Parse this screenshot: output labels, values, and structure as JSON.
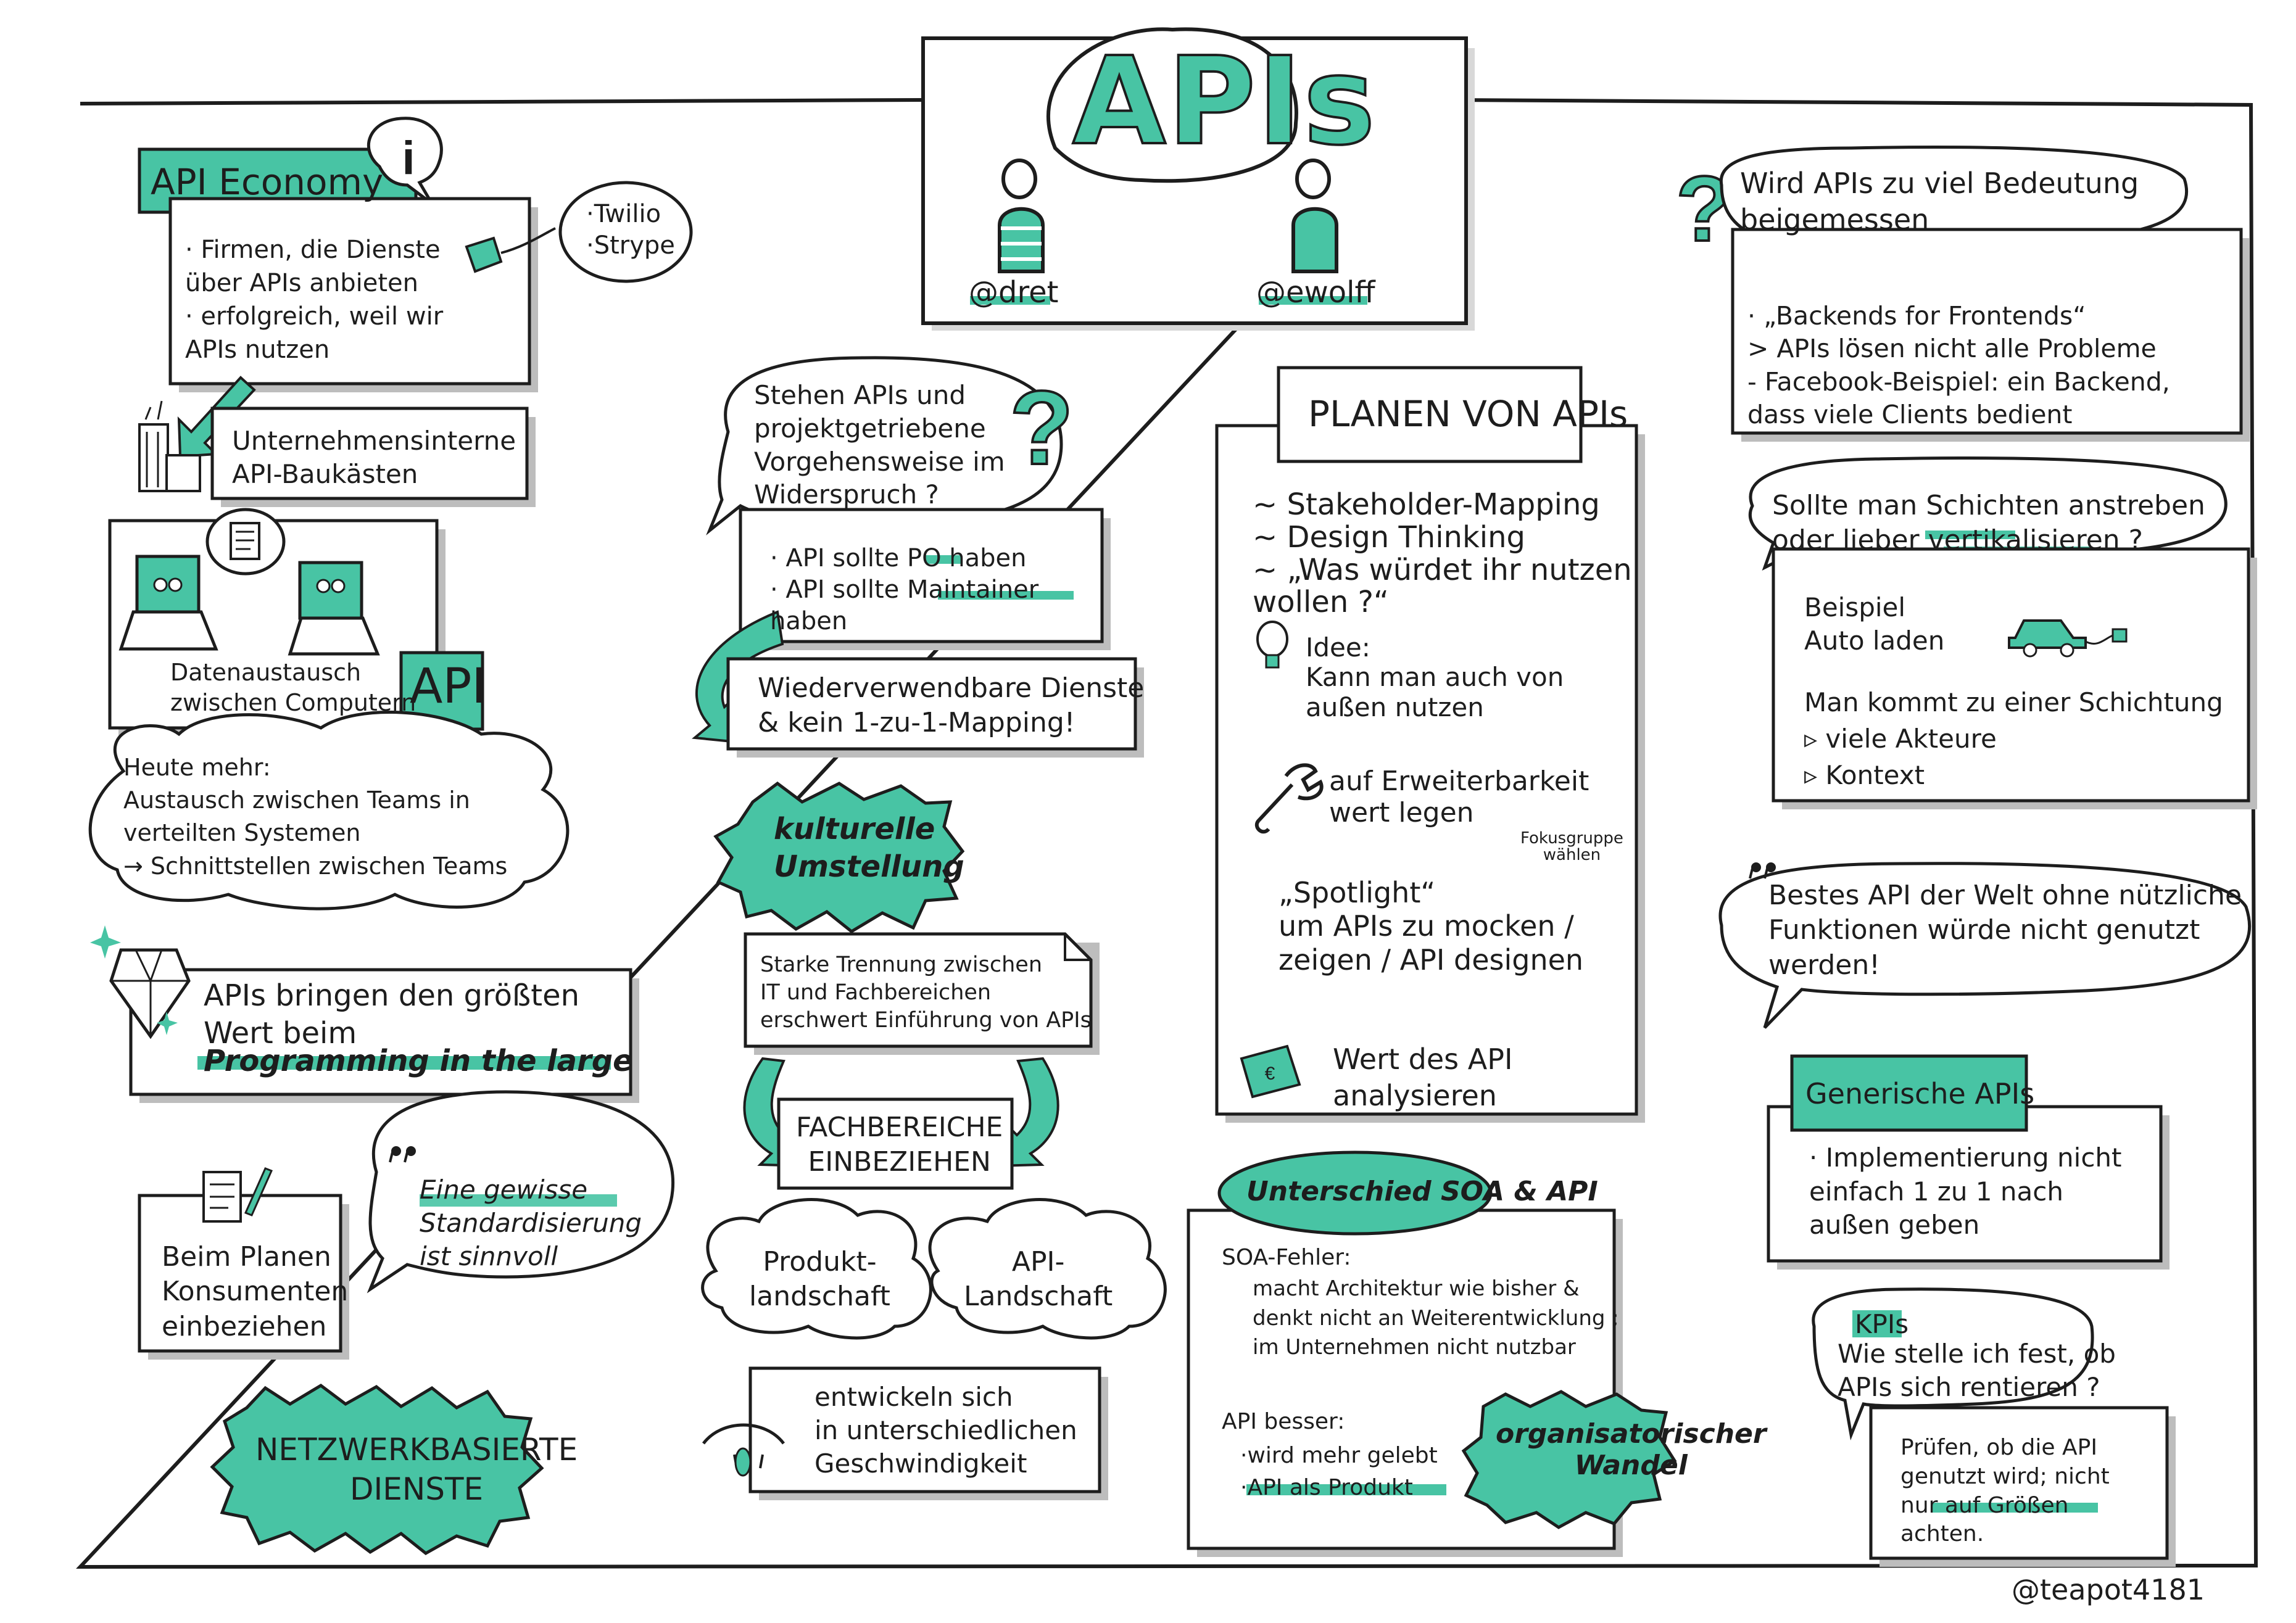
{
  "header": {
    "title": "APIs",
    "person_left": "@dret",
    "person_right": "@ewolff"
  },
  "colors": {
    "accent": "#48c4a4",
    "ink": "#1d1d1d",
    "shadow": "#bdbdbd",
    "paper": "#ffffff"
  },
  "icons": {
    "info": "info-icon",
    "question": "question-mark-icon",
    "money": "money-bill-icon",
    "building": "office-building-icon",
    "computer": "computer-icon",
    "document": "document-icon",
    "diamond": "diamond-icon",
    "lightbulb": "lightbulb-icon",
    "wrench": "wrench-icon",
    "euro": "euro-bill-icon",
    "car": "electric-car-icon",
    "eye": "eye-icon",
    "quote": "quote-icon",
    "checklist": "checklist-pen-icon"
  },
  "left": {
    "api_economy": {
      "title": "API Economy",
      "body": "· Firmen, die Dienste\n  über APIs anbieten\n· erfolgreich, weil wir\n  APIs nutzen",
      "examples": "·Twilio\n·Strype"
    },
    "baukasten": "Unternehmensinterne\nAPI-Baukästen",
    "computers": {
      "caption": "Datenaustausch\nzwischen Computern",
      "api_tag": "API"
    },
    "cloud": "Heute mehr:\n  Austausch zwischen Teams in\n  verteilten Systemen\n    → Schnittstellen zwischen Teams",
    "large": {
      "line1": "APIs bringen den größten\nWert beim",
      "highlight": "Programming in the large"
    },
    "consumers": "Beim Planen\nKonsumenten\neinbeziehen",
    "quote": "Eine gewisse\nStandardisierung\nist sinnvoll",
    "netzwerk": "NETZWERKBASIERTE\nDIENSTE"
  },
  "center": {
    "question": "Stehen APIs und\nprojektgetriebene\nVorgehensweise im\nWiderspruch ?",
    "po_box": "· API sollte PO haben\n· API sollte Maintainer\n  haben",
    "reuse": "Wiederverwendbare Dienste\n& kein 1-zu-1-Mapping!",
    "kulturell": "kulturelle\nUmstellung",
    "trennung": "Starke Trennung zwischen\nIT und Fachbereichen\nerschwert Einführung von APIs",
    "fachbereiche": "FACHBEREICHE\nEINBEZIEHEN",
    "cloud_produkt": "Produkt-\nlandschaft",
    "cloud_api": "API-\nLandschaft",
    "develop": "entwickeln sich\nin unterschiedlichen\nGeschwindigkeit"
  },
  "planen": {
    "title": "PLANEN VON APIs",
    "methods": "~ Stakeholder-Mapping\n~ Design Thinking\n~ „Was würdet ihr nutzen\n   wollen ?“",
    "idee": "Idee:\nKann man auch von\naußen nutzen",
    "erweiterbarkeit": "auf Erweiterbarkeit\nwert legen",
    "fokus": "Fokusgruppe\nwählen",
    "spotlight": "„Spotlight“\num APIs zu mocken /\nzeigen / API designen",
    "wert": "Wert des API\nanalysieren"
  },
  "soa": {
    "title": "Unterschied SOA & API",
    "fehler_label": "SOA-Fehler:",
    "fehler": "macht Architektur wie bisher &\ndenkt nicht an Weiterentwicklung ;\nim Unternehmen nicht nutzbar",
    "besser_label": "API besser:",
    "besser": "·wird mehr gelebt\n·API als Produkt",
    "wandel": "organisatorischer\nWandel"
  },
  "right": {
    "question": "Wird APIs zu viel Bedeutung\nbeigemessen",
    "bff": "· „Backends for Frontends“\n> APIs lösen nicht alle Probleme\n- Facebook-Beispiel: ein Backend,\n  dass viele Clients bedient",
    "schichten": "Sollte man Schichten anstreben\noder lieber vertikalisieren ?",
    "beispiel": "Beispiel\n  Auto laden",
    "schichtung": "Man kommt zu einer Schichtung\n  ▹ viele Akteure\n  ▹ Kontext",
    "best_api": "Bestes API der Welt ohne nützliche\nFunktionen würde nicht genutzt\nwerden!",
    "generische_title": "Generische APIs",
    "generische": "· Implementierung nicht\n  einfach 1 zu 1 nach\n  außen geben",
    "kpi_title": "KPIs",
    "kpi": "Wie stelle ich fest, ob\nAPIs sich rentieren ?",
    "pruefen": "Prüfen, ob die API\ngenutzt wird; nicht\nnur auf Größen\nachten."
  },
  "footer": {
    "author": "@teapot4181"
  }
}
